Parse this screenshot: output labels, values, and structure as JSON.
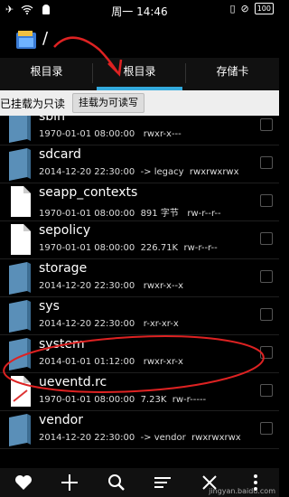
{
  "status_bar": {
    "time": "周一 14:46",
    "battery": "100"
  },
  "title_bar": {
    "path": "/"
  },
  "tabs": [
    {
      "label": "根目录"
    },
    {
      "label": "根目录"
    },
    {
      "label": "存储卡"
    }
  ],
  "mount": {
    "status": "已挂载为只读",
    "button": "挂载为可读写"
  },
  "files": [
    {
      "name": "sbin",
      "meta": "1970-01-01 08:00:00   rwxr-x---",
      "type": "folder"
    },
    {
      "name": "sdcard",
      "meta": "2014-12-20 22:30:00  -> legacy  rwxrwxrwx",
      "type": "folder"
    },
    {
      "name": "seapp_contexts",
      "meta": "1970-01-01 08:00:00  891 字节   rw-r--r--",
      "type": "file"
    },
    {
      "name": "sepolicy",
      "meta": "1970-01-01 08:00:00  226.71K  rw-r--r--",
      "type": "file"
    },
    {
      "name": "storage",
      "meta": "2014-12-20 22:30:00   rwxr-x--x",
      "type": "folder"
    },
    {
      "name": "sys",
      "meta": "2014-12-20 22:30:00   r-xr-xr-x",
      "type": "folder"
    },
    {
      "name": "system",
      "meta": "2014-01-01 01:12:00   rwxr-xr-x",
      "type": "folder"
    },
    {
      "name": "ueventd.rc",
      "meta": "1970-01-01 08:00:00  7.23K  rw-r-----",
      "type": "file"
    },
    {
      "name": "vendor",
      "meta": "2014-12-20 22:30:00  -> vendor  rwxrwxrwx",
      "type": "folder"
    }
  ],
  "watermark": "jingyan.baidu.com",
  "icons": [
    "heart-icon",
    "plus-icon",
    "search-icon",
    "sort-icon",
    "close-icon",
    "more-icon"
  ]
}
